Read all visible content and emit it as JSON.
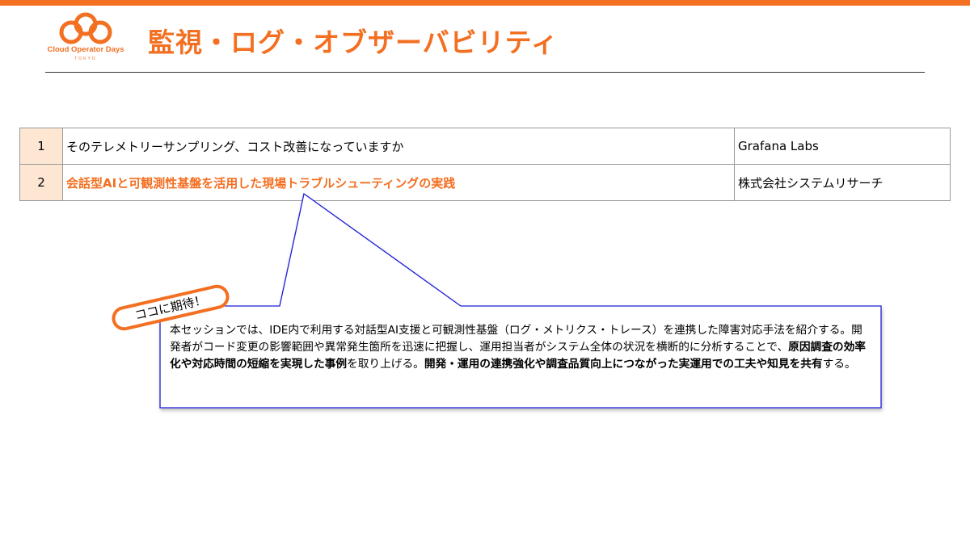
{
  "logo": {
    "name": "Cloud Operator Days",
    "sub": "TOKYO"
  },
  "page_title": "監視・ログ・オブザーバビリティ",
  "sessions": [
    {
      "num": "1",
      "title": "そのテレメトリーサンプリング、コスト改善になっていますか",
      "org": "Grafana Labs",
      "highlighted": false
    },
    {
      "num": "2",
      "title": "会話型AIと可観測性基盤を活用した現場トラブルシューティングの実践",
      "org": "株式会社システムリサーチ",
      "highlighted": true
    }
  ],
  "badge": "ココに期待！",
  "callout": {
    "p1": "本セッションでは、IDE内で利用する対話型AI支援と可観測性基盤（ログ・メトリクス・トレース）を連携した障害対応手法を紹介する。開発者がコード変更の影響範囲や異常発生箇所を迅速に把握し、運用担当者がシステム全体の状況を横断的に分析することで、",
    "b1": "原因調査の効率化や対応時間の短縮を実現した事例",
    "p2": "を取り上げる。",
    "b2": "開発・運用の連携強化や調査品質向上につながった実運用での工夫や知見を共有",
    "p3": "する。"
  },
  "colors": {
    "accent": "#f36f21",
    "callout_border": "#1f1fd8",
    "number_cell_bg": "#fde6d2"
  }
}
